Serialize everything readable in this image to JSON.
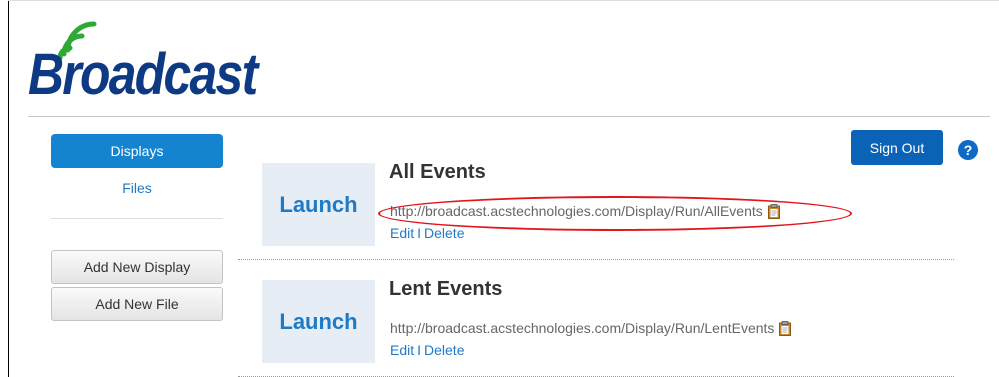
{
  "app": {
    "logo_text": "Broadcast"
  },
  "sidebar": {
    "active_item": "Displays",
    "link_item": "Files",
    "add_display_label": "Add New Display",
    "add_file_label": "Add New File"
  },
  "header": {
    "sign_out_label": "Sign Out",
    "help_label": "?"
  },
  "displays": [
    {
      "launch_label": "Launch",
      "title": "All Events",
      "url": "http://broadcast.acstechnologies.com/Display/Run/AllEvents",
      "edit_label": "Edit",
      "separator": "I",
      "delete_label": "Delete",
      "highlighted": true
    },
    {
      "launch_label": "Launch",
      "title": "Lent Events",
      "url": "http://broadcast.acstechnologies.com/Display/Run/LentEvents",
      "edit_label": "Edit",
      "separator": "I",
      "delete_label": "Delete",
      "highlighted": false
    }
  ],
  "colors": {
    "brand_navy": "#0d3a82",
    "brand_green": "#2fa836",
    "accent_blue": "#1584d0",
    "signout_blue": "#0b63b7",
    "link_blue": "#1f7ac6",
    "highlight_red": "#e1151b"
  },
  "icons": {
    "logo_waves": "signal-waves-icon",
    "copy": "clipboard-icon",
    "help": "question-icon"
  }
}
